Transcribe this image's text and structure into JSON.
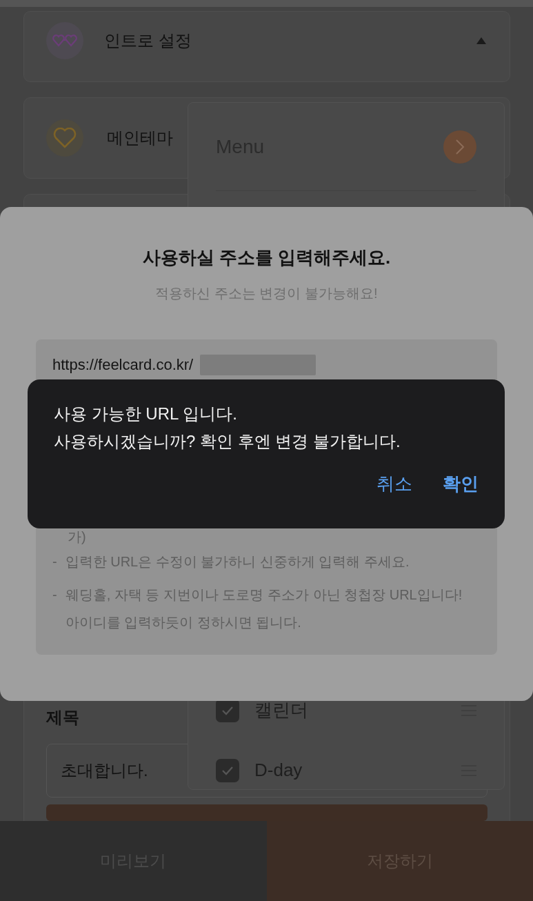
{
  "intro_card": {
    "title": "인트로 설정",
    "expanded": true
  },
  "theme_card": {
    "title": "메인테마"
  },
  "menu_panel": {
    "title": "Menu",
    "items": [
      {
        "label": "캘린더",
        "checked": true
      },
      {
        "label": "D-day",
        "checked": true
      }
    ]
  },
  "title_section": {
    "label": "제목",
    "value": "초대합니다."
  },
  "footer": {
    "buttons": [
      {
        "label": "미리보기",
        "kind": "secondary"
      },
      {
        "label": "저장하기",
        "kind": "primary"
      }
    ]
  },
  "url_sheet": {
    "title": "사용하실 주소를 입력해주세요.",
    "subtitle": "적용하신 주소는 변경이 불가능해요!",
    "url_prefix": "https://feelcard.co.kr/",
    "partial_note": "가)",
    "notes": [
      {
        "bullet": "-",
        "text": "입력한 URL은 수정이 불가하니 신중하게 입력해 주세요."
      },
      {
        "bullet": "-",
        "text": "웨딩홀, 자택 등 지번이나 도로명 주소가 아닌 청첩장 URL입니다! 아이디를 입력하듯이 정하시면 됩니다."
      }
    ]
  },
  "alert": {
    "message": [
      "사용 가능한 URL 입니다.",
      "사용하시겠습니까? 확인 후엔 변경 불가합니다."
    ],
    "buttons": [
      {
        "label": "취소",
        "kind": "cancel"
      },
      {
        "label": "확인",
        "kind": "confirm"
      }
    ]
  }
}
